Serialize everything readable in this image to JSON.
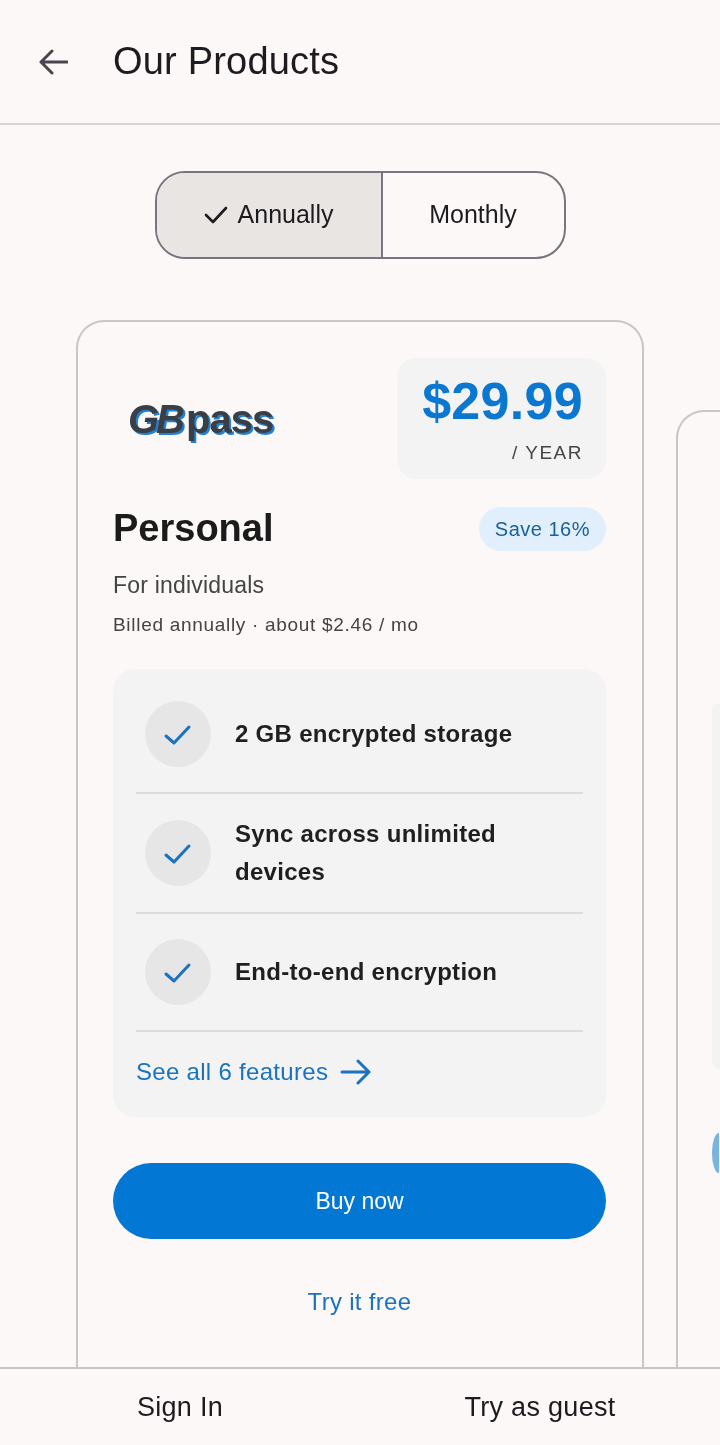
{
  "header": {
    "title": "Our Products"
  },
  "billing_toggle": [
    {
      "label": "Annually",
      "selected": true
    },
    {
      "label": "Monthly",
      "selected": false
    }
  ],
  "plans": [
    {
      "kind": "full",
      "logo": {
        "mark": "GB",
        "word": "pass"
      },
      "price": "$29.99",
      "period": "/ YEAR",
      "name": "Personal",
      "badge": "Save 16%",
      "subtitle": "For individuals",
      "billing": "Billed annually · about $2.46 / mo",
      "features": [
        "2 GB encrypted storage",
        "Sync across unlimited devices",
        "End-to-end encryption"
      ],
      "features_link": "See all 6 features",
      "primary_button": "Buy now",
      "secondary_link": "Try it free"
    },
    {
      "kind": "cut_off"
    }
  ],
  "footer": {
    "buttons": [
      "Sign In",
      "Try as guest"
    ]
  }
}
